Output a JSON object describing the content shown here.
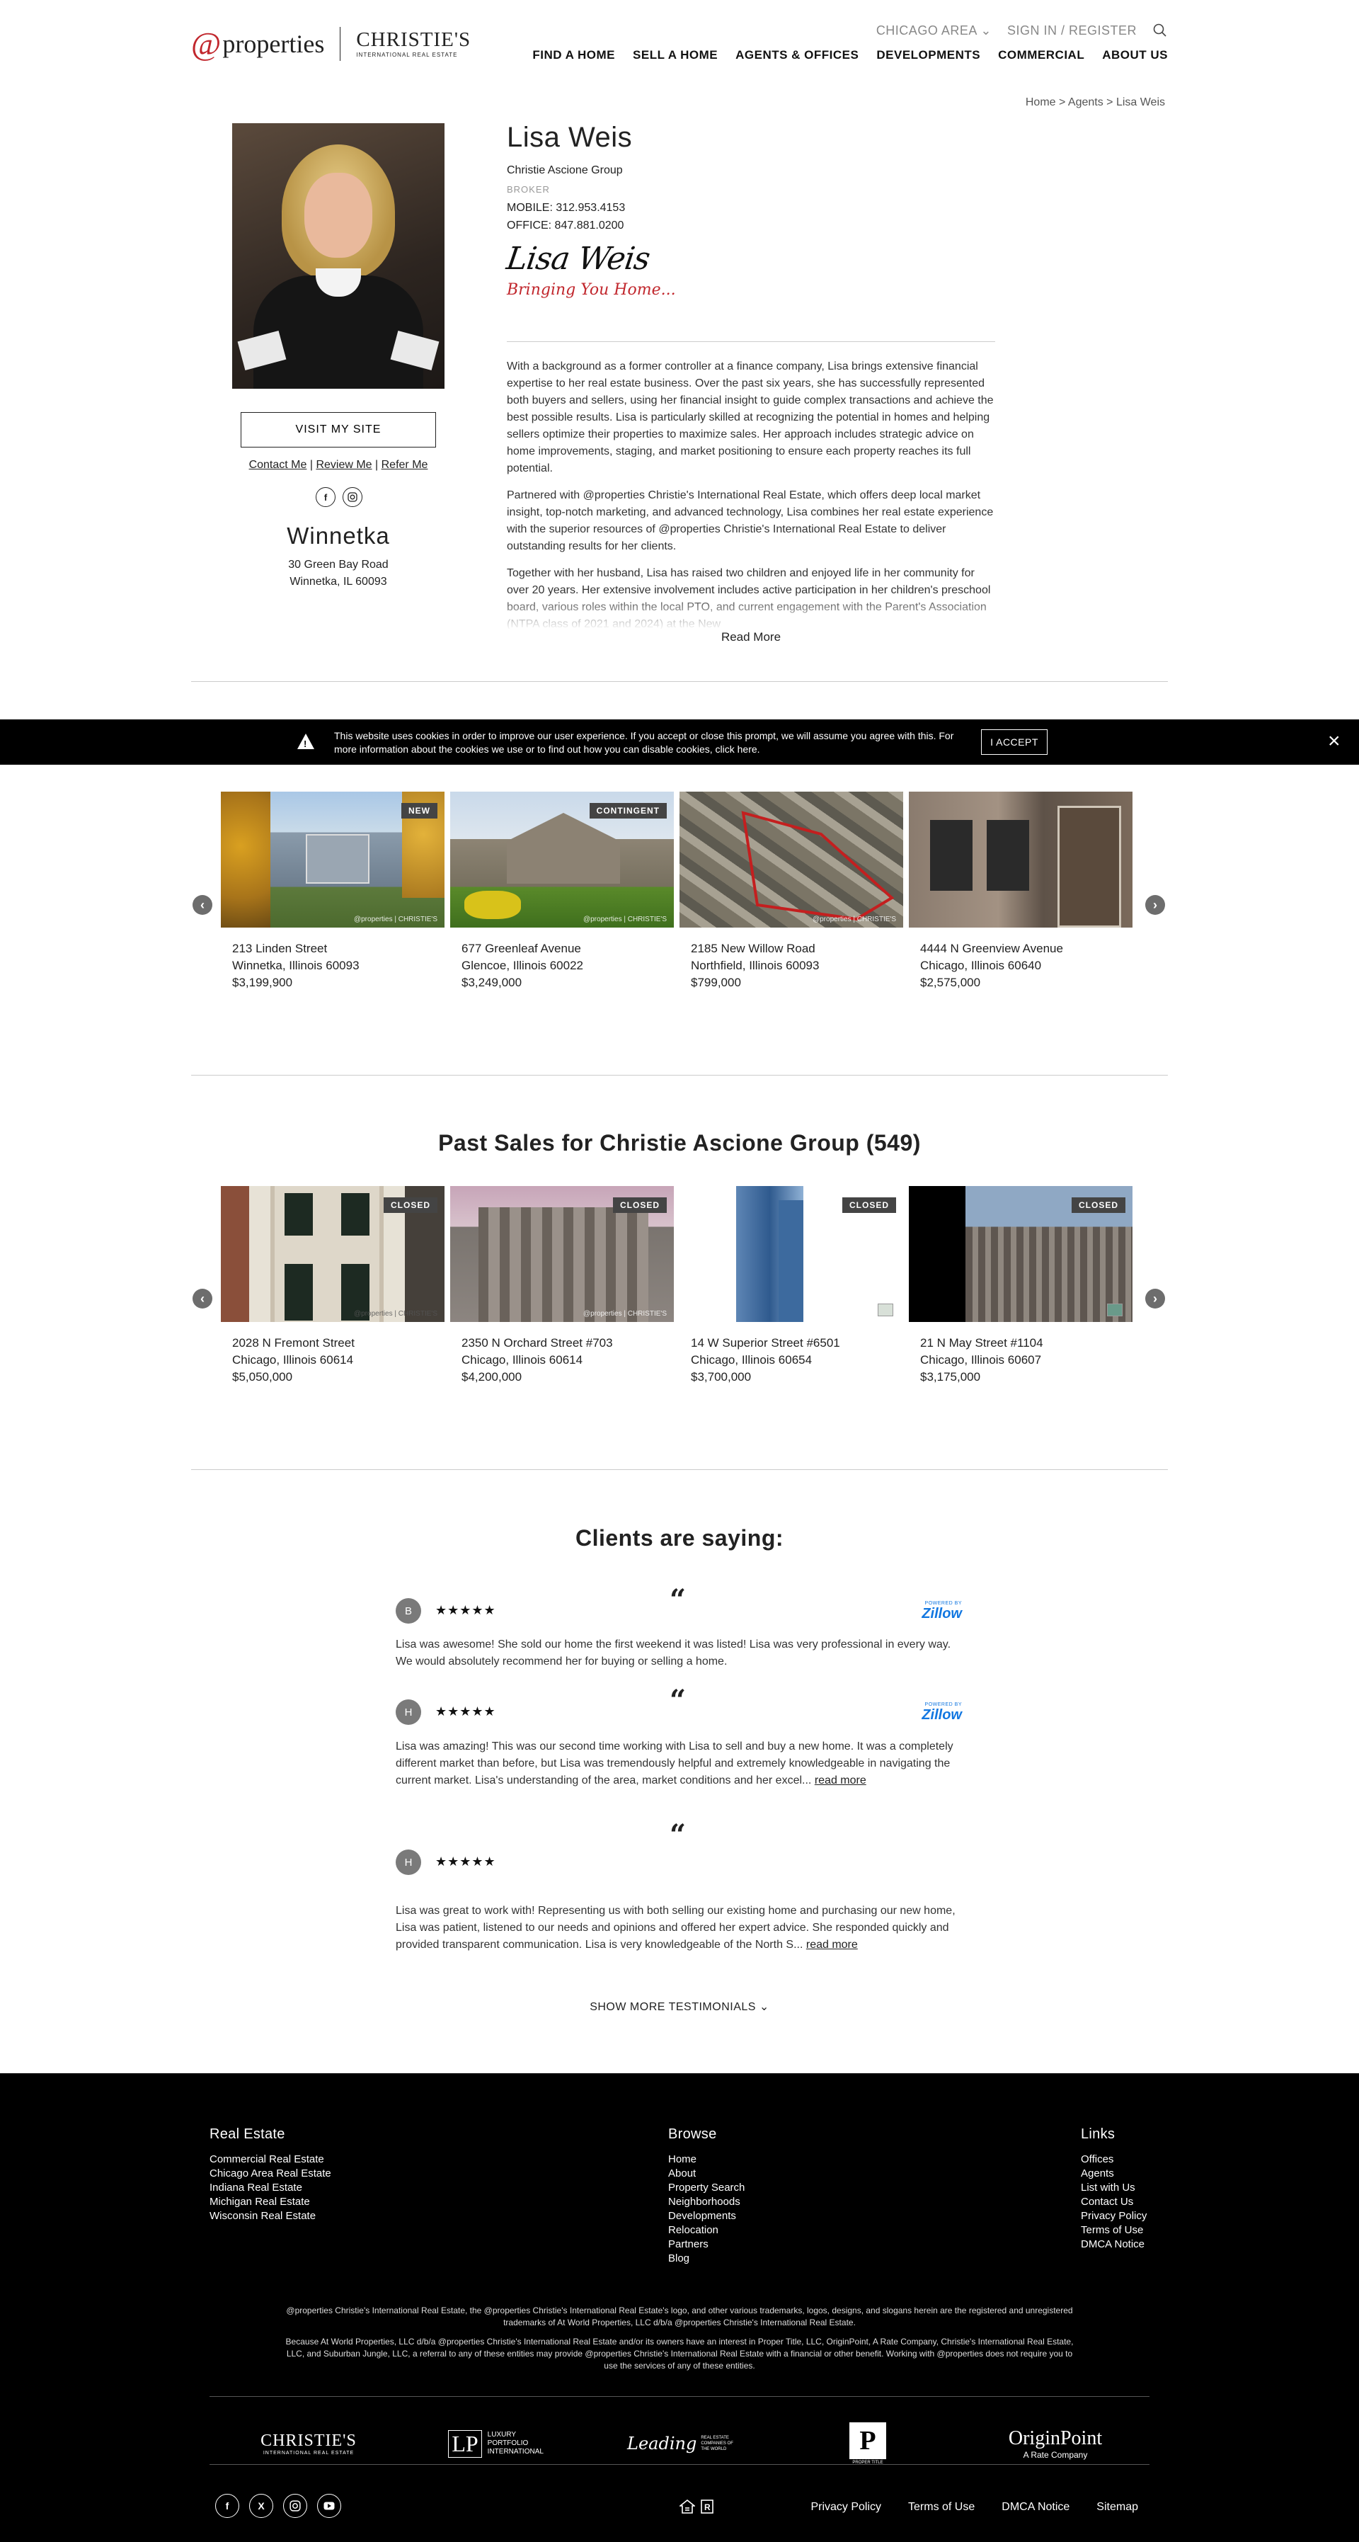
{
  "header": {
    "logo_at": "@",
    "logo_word": "properties",
    "logo_christies": "CHRISTIE'S",
    "logo_christies_sub": "INTERNATIONAL REAL ESTATE",
    "region_selector": "CHICAGO AREA",
    "sign_in": "SIGN IN / REGISTER",
    "nav": [
      "FIND A HOME",
      "SELL A HOME",
      "AGENTS & OFFICES",
      "DEVELOPMENTS",
      "COMMERCIAL",
      "ABOUT US"
    ]
  },
  "breadcrumb": "Home > Agents > Lisa Weis",
  "agent": {
    "name": "Lisa Weis",
    "group": "Christie Ascione Group",
    "title": "BROKER",
    "mobile": "MOBILE: 312.953.4153",
    "office": "OFFICE: 847.881.0200",
    "signature_name": "Lisa Weis",
    "signature_tagline": "Bringing You Home...",
    "visit_site": "VISIT MY SITE",
    "contact_links": [
      "Contact Me",
      "Review Me",
      "Refer Me"
    ],
    "social": [
      "facebook-icon",
      "instagram-icon"
    ],
    "office_city": "Winnetka",
    "office_address_1": "30 Green Bay Road",
    "office_address_2": "Winnetka, IL 60093",
    "bio": [
      "With a background as a former controller at a finance company, Lisa brings extensive financial expertise to her real estate business. Over the past six years, she has successfully represented both buyers and sellers, using her financial insight to guide complex transactions and achieve the best possible results. Lisa is particularly skilled at recognizing the potential in homes and helping sellers optimize their properties to maximize sales. Her approach includes strategic advice on home improvements, staging, and market positioning to ensure each property reaches its full potential.",
      "Partnered with @properties Christie's International Real Estate, which offers deep local market insight, top-notch marketing, and advanced technology, Lisa combines her real estate experience with the superior resources of @properties Christie's International Real Estate to deliver outstanding results for her clients.",
      "Together with her husband, Lisa has raised two children and enjoyed life in her community for over 20 years. Her extensive involvement includes active participation in her children's preschool board, various roles within the local PTO, and current engagement with the Parent's Association (NTPA class of 2021 and 2024) at the New"
    ],
    "read_more": "Read More"
  },
  "cookie": {
    "text": "This website uses cookies in order to improve our user experience. If you accept or close this prompt, we will assume you agree with this. For more information about the cookies we use or to find out how you can disable cookies, click here.",
    "accept": "I ACCEPT",
    "close": "×"
  },
  "active_listings": [
    {
      "address": "213 Linden Street",
      "city": "Winnetka, Illinois 60093",
      "price": "$3,199,900",
      "badge": "NEW"
    },
    {
      "address": "677 Greenleaf Avenue",
      "city": "Glencoe, Illinois 60022",
      "price": "$3,249,000",
      "badge": "CONTINGENT"
    },
    {
      "address": "2185 New Willow Road",
      "city": "Northfield, Illinois 60093",
      "price": "$799,000",
      "badge": ""
    },
    {
      "address": "4444 N Greenview Avenue",
      "city": "Chicago, Illinois 60640",
      "price": "$2,575,000",
      "badge": ""
    }
  ],
  "past_sales": {
    "title": "Past Sales for Christie Ascione Group (549)",
    "items": [
      {
        "address": "2028 N Fremont Street",
        "city": "Chicago, Illinois 60614",
        "price": "$5,050,000",
        "badge": "CLOSED"
      },
      {
        "address": "2350 N Orchard Street #703",
        "city": "Chicago, Illinois 60614",
        "price": "$4,200,000",
        "badge": "CLOSED"
      },
      {
        "address": "14 W Superior Street #6501",
        "city": "Chicago, Illinois 60654",
        "price": "$3,700,000",
        "badge": "CLOSED"
      },
      {
        "address": "21 N May Street #1104",
        "city": "Chicago, Illinois 60607",
        "price": "$3,175,000",
        "badge": "CLOSED"
      }
    ]
  },
  "testimonials": {
    "title": "Clients are saying:",
    "quote_glyph": "“",
    "zillow_powered": "POWERED BY",
    "zillow_label": "Zillow",
    "items": [
      {
        "initial": "B",
        "stars": "★★★★★",
        "text": "Lisa was awesome! She sold our home the first weekend it was listed! Lisa was very professional in every way. We would absolutely recommend her for buying or selling a home.",
        "read_more": ""
      },
      {
        "initial": "H",
        "stars": "★★★★★",
        "text": "Lisa was amazing! This was our second time working with Lisa to sell and buy a new home. It was a completely different market than before, but Lisa was tremendously helpful and extremely knowledgeable in navigating the current market. Lisa's understanding of the area, market conditions and her excel... ",
        "read_more": "read more"
      },
      {
        "initial": "H",
        "stars": "★★★★★",
        "text": "Lisa was great to work with! Representing us with both selling our existing home and purchasing our new home, Lisa was patient, listened to our needs and opinions and offered her expert advice. She responded quickly and provided transparent communication. Lisa is very knowledgeable of the North S... ",
        "read_more": "read more"
      }
    ],
    "show_more": "SHOW MORE TESTIMONIALS"
  },
  "footer": {
    "columns": [
      {
        "title": "Real Estate",
        "items": [
          "Commercial Real Estate",
          "Chicago Area Real Estate",
          "Indiana Real Estate",
          "Michigan Real Estate",
          "Wisconsin Real Estate"
        ]
      },
      {
        "title": "Browse",
        "items": [
          "Home",
          "About",
          "Property Search",
          "Neighborhoods",
          "Developments",
          "Relocation",
          "Partners",
          "Blog"
        ]
      },
      {
        "title": "Links",
        "items": [
          "Offices",
          "Agents",
          "List with Us",
          "Contact Us",
          "Privacy Policy",
          "Terms of Use",
          "DMCA Notice"
        ]
      }
    ],
    "legal_1": "@properties Christie's International Real Estate, the @properties Christie's International Real Estate's logo, and other various trademarks, logos, designs, and slogans herein are the registered and unregistered trademarks of At World Properties, LLC d/b/a @properties Christie's International Real Estate.",
    "legal_2": "Because At World Properties, LLC d/b/a @properties Christie's International Real Estate and/or its owners have an interest in Proper Title, LLC, OriginPoint, A Rate Company, Christie's International Real Estate, LLC, and Suburban Jungle, LLC, a referral to any of these entities may provide @properties Christie's International Real Estate with a financial or other benefit. Working with @properties does not require you to use the services of any of these entities.",
    "brands": {
      "christies": "CHRISTIE'S",
      "christies_sub": "INTERNATIONAL REAL ESTATE",
      "luxury": "LUXURY PORTFOLIO INTERNATIONAL",
      "leading": "Leading",
      "leading_sub": "REAL ESTATE COMPANIES OF THE WORLD",
      "proper": "P",
      "proper_sub": "PROPER TITLE",
      "origin": "OriginPoint",
      "origin_sub": "A Rate Company"
    },
    "social": [
      "facebook-icon",
      "x-icon",
      "instagram-icon",
      "youtube-icon"
    ],
    "bottom_links": [
      "Privacy Policy",
      "Terms of Use",
      "DMCA Notice",
      "Sitemap"
    ]
  }
}
